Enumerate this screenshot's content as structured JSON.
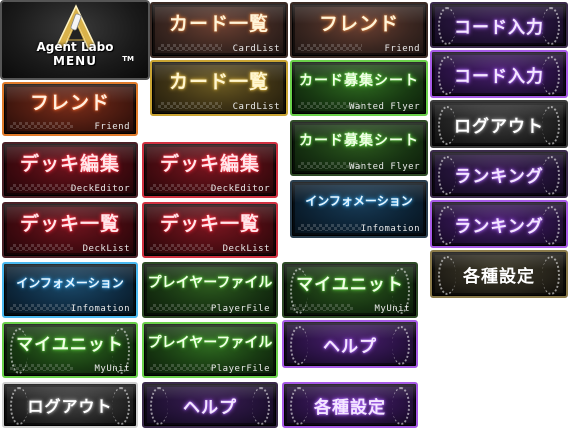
{
  "logo": {
    "line1": "Agent Labo",
    "line2": "MENU",
    "tm": "TM",
    "icon": "agent-labo-emblem"
  },
  "buttons": {
    "card_list_1": {
      "main": "カード一覧",
      "sub": "CardList"
    },
    "friend_1": {
      "main": "フレンド",
      "sub": "Friend"
    },
    "code_input_1": {
      "main": "コード入力"
    },
    "card_list_2": {
      "main": "カード一覧",
      "sub": "CardList"
    },
    "wanted_1": {
      "main": "カード募集シート",
      "sub": "Wanted Flyer"
    },
    "code_input_2": {
      "main": "コード入力"
    },
    "friend_2": {
      "main": "フレンド",
      "sub": "Friend"
    },
    "wanted_2": {
      "main": "カード募集シート",
      "sub": "Wanted Flyer"
    },
    "logout_1": {
      "main": "ログアウト"
    },
    "deck_editor_1": {
      "main": "デッキ編集",
      "sub": "DeckEditor"
    },
    "deck_editor_2": {
      "main": "デッキ編集",
      "sub": "DeckEditor"
    },
    "ranking_1": {
      "main": "ランキング"
    },
    "info_1": {
      "main": "インフォメーション",
      "sub": "Infomation"
    },
    "deck_list_1": {
      "main": "デッキ一覧",
      "sub": "DeckList"
    },
    "deck_list_2": {
      "main": "デッキ一覧",
      "sub": "DeckList"
    },
    "ranking_2": {
      "main": "ランキング"
    },
    "settings_1": {
      "main": "各種設定"
    },
    "info_2": {
      "main": "インフォメーション",
      "sub": "Infomation"
    },
    "player_file_1": {
      "main": "プレイヤーファイル",
      "sub": "PlayerFile"
    },
    "my_unit_1": {
      "main": "マイユニット",
      "sub": "MyUnit"
    },
    "my_unit_2": {
      "main": "マイユニット",
      "sub": "MyUnit"
    },
    "player_file_2": {
      "main": "プレイヤーファイル",
      "sub": "PlayerFile"
    },
    "help_1": {
      "main": "ヘルプ"
    },
    "logout_2": {
      "main": "ログアウト"
    },
    "help_2": {
      "main": "ヘルプ"
    },
    "settings_2": {
      "main": "各種設定"
    }
  },
  "colors": {
    "background": "#ffffff",
    "gold_glow": "#e0b840",
    "orange_glow": "#ff6a2a",
    "red_glow": "#ff2a3c",
    "green_glow": "#5ad03a",
    "blue_glow": "#3ab0ff",
    "purple_glow": "#b06aff"
  }
}
